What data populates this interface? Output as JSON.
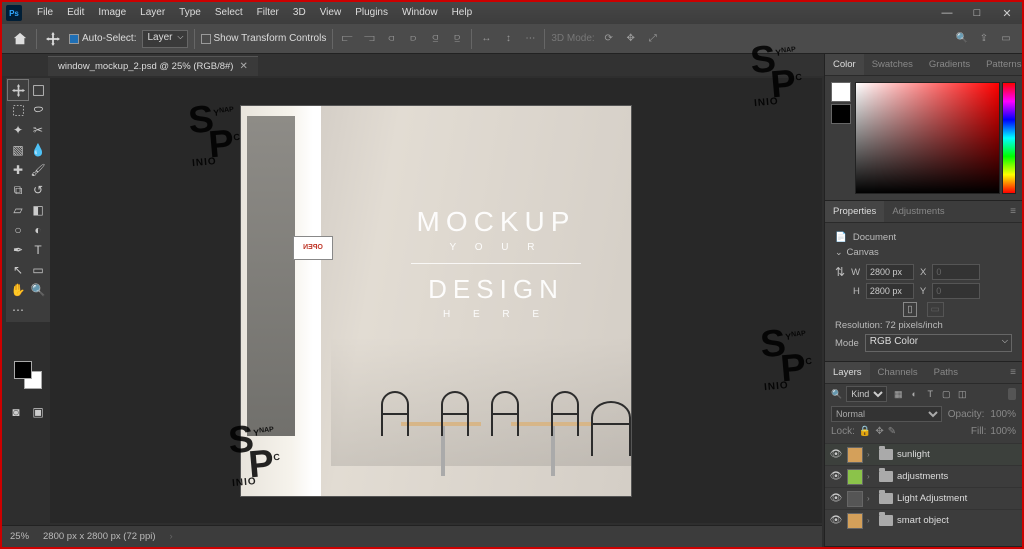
{
  "menu": [
    "File",
    "Edit",
    "Image",
    "Layer",
    "Type",
    "Select",
    "Filter",
    "3D",
    "View",
    "Plugins",
    "Window",
    "Help"
  ],
  "options": {
    "auto_select": "Auto-Select:",
    "auto_select_target": "Layer",
    "show_transform": "Show Transform Controls",
    "mode_3d": "3D Mode:"
  },
  "tab": {
    "title": "window_mockup_2.psd @ 25% (RGB/8#)"
  },
  "canvas_text": {
    "line1": "MOCKUP",
    "line2": "Y O U R",
    "line3": "DESIGN",
    "line4": "H E R E",
    "open": "OPEN"
  },
  "panels": {
    "color_tabs": [
      "Color",
      "Swatches",
      "Gradients",
      "Patterns"
    ],
    "props_tabs": [
      "Properties",
      "Adjustments"
    ],
    "props_doc": "Document",
    "canvas_section": "Canvas",
    "w_label": "W",
    "w_val": "2800 px",
    "h_label": "H",
    "h_val": "2800 px",
    "x_label": "X",
    "x_val": "0",
    "y_label": "Y",
    "y_val": "0",
    "resolution": "Resolution: 72 pixels/inch",
    "mode": "Mode",
    "mode_val": "RGB Color",
    "layer_tabs": [
      "Layers",
      "Channels",
      "Paths"
    ],
    "kind": "Kind",
    "blend": "Normal",
    "opacity_label": "Opacity:",
    "opacity_val": "100%",
    "lock": "Lock:",
    "fill_label": "Fill:",
    "fill_val": "100%",
    "layers": [
      {
        "name": "sunlight",
        "color": "orange"
      },
      {
        "name": "adjustments",
        "color": "green"
      },
      {
        "name": "Light Adjustment",
        "color": "none"
      },
      {
        "name": "smart object",
        "color": "orange"
      }
    ]
  },
  "status": {
    "zoom": "25%",
    "dims": "2800 px x 2800 px (72 ppi)"
  }
}
